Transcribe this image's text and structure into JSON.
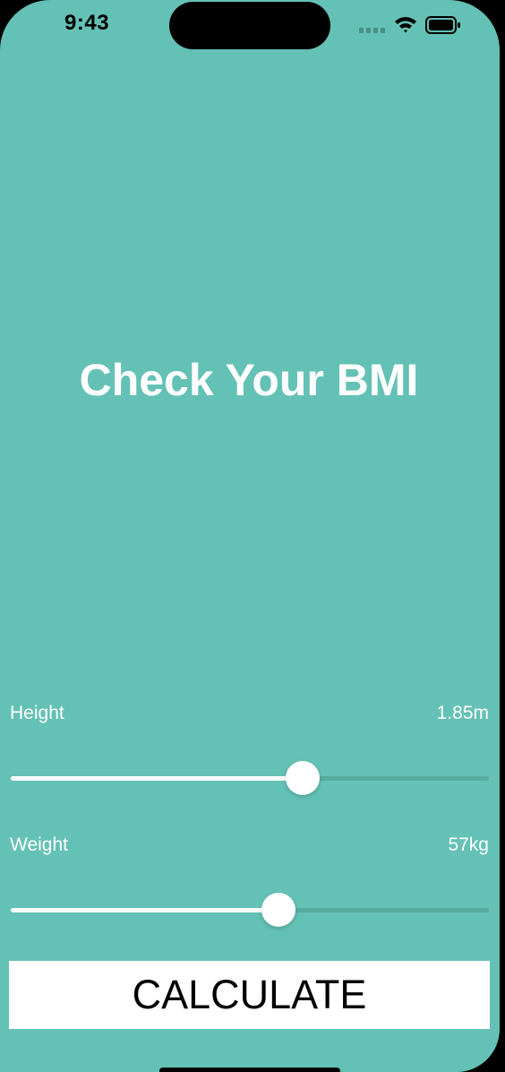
{
  "status_bar": {
    "time": "9:43",
    "icons": [
      "cellular-signal-icon",
      "wifi-icon",
      "battery-icon"
    ]
  },
  "title": "Check Your BMI",
  "height": {
    "label": "Height",
    "value_text": "1.85m",
    "slider_fraction": 0.61
  },
  "weight": {
    "label": "Weight",
    "value_text": "57kg",
    "slider_fraction": 0.56
  },
  "calculate_label": "CALCULATE",
  "colors": {
    "background": "#64c1b5",
    "track_unfilled": "#58ab9f",
    "foreground": "#ffffff",
    "button_text": "#000000"
  }
}
